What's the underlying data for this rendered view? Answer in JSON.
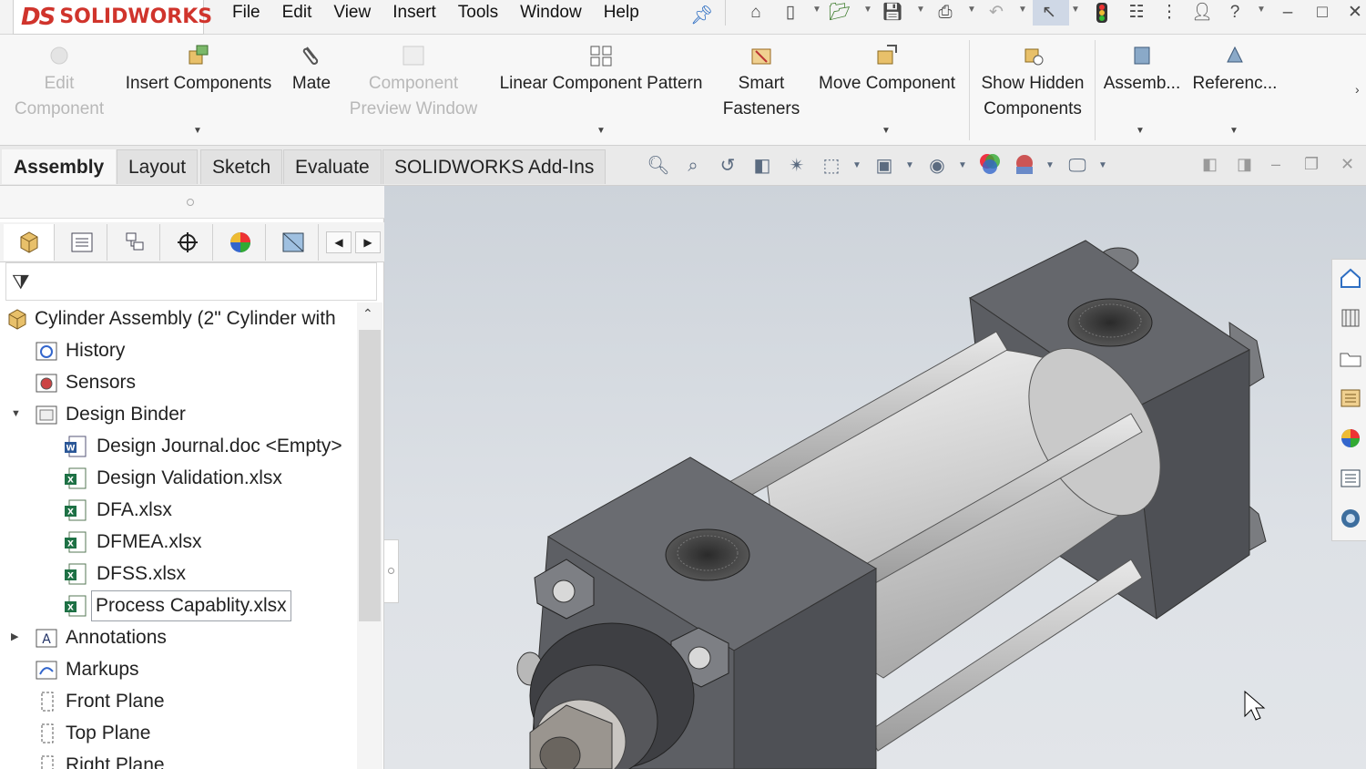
{
  "app": {
    "brand_ds": "DS",
    "brand_name": "SOLIDWORKS"
  },
  "menu": [
    "File",
    "Edit",
    "View",
    "Insert",
    "Tools",
    "Window",
    "Help"
  ],
  "ribbon": {
    "edit_component": [
      "Edit",
      "Component"
    ],
    "insert_components": "Insert Components",
    "mate": "Mate",
    "component_preview": [
      "Component",
      "Preview Window"
    ],
    "linear_pattern": "Linear Component Pattern",
    "smart_fasteners": [
      "Smart",
      "Fasteners"
    ],
    "move_component": "Move Component",
    "show_hidden": [
      "Show Hidden",
      "Components"
    ],
    "assembly": "Assemb...",
    "reference": "Referenc..."
  },
  "tabs": [
    "Assembly",
    "Layout",
    "Sketch",
    "Evaluate",
    "SOLIDWORKS Add-Ins"
  ],
  "tree": {
    "root": "Cylinder Assembly  (2\" Cylinder with",
    "items": [
      {
        "label": "History",
        "icon": "history-icon"
      },
      {
        "label": "Sensors",
        "icon": "sensors-icon"
      },
      {
        "label": "Design Binder",
        "icon": "binder-icon"
      },
      {
        "label": "Design Journal.doc <Empty>",
        "icon": "word-doc-icon"
      },
      {
        "label": "Design Validation.xlsx",
        "icon": "excel-icon"
      },
      {
        "label": "DFA.xlsx",
        "icon": "excel-icon"
      },
      {
        "label": "DFMEA.xlsx",
        "icon": "excel-icon"
      },
      {
        "label": "DFSS.xlsx",
        "icon": "excel-icon"
      },
      {
        "label": "Process Capablity.xlsx",
        "icon": "excel-icon"
      },
      {
        "label": "Annotations",
        "icon": "annotations-icon"
      },
      {
        "label": "Markups",
        "icon": "markups-icon"
      },
      {
        "label": "Front Plane",
        "icon": "plane-icon"
      },
      {
        "label": "Top Plane",
        "icon": "plane-icon"
      },
      {
        "label": "Right Plane",
        "icon": "plane-icon"
      }
    ]
  },
  "colors": {
    "brand_red": "#d0342c",
    "part_gray": "#6e7075",
    "barrel": "#d4d4d4"
  }
}
